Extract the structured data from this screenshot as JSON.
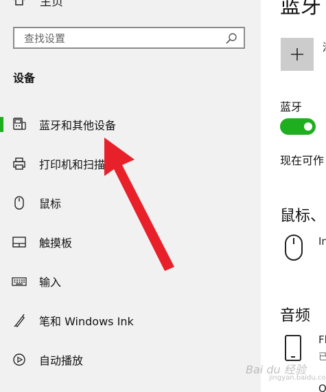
{
  "nav": {
    "home_label": "主页",
    "search": {
      "placeholder": "查找设置",
      "value": ""
    },
    "section_title": "设备",
    "items": [
      {
        "label": "蓝牙和其他设备",
        "icon": "bluetooth-devices-icon",
        "selected": true
      },
      {
        "label": "打印机和扫描仪",
        "icon": "printer-icon",
        "selected": false
      },
      {
        "label": "鼠标",
        "icon": "mouse-icon",
        "selected": false
      },
      {
        "label": "触摸板",
        "icon": "touchpad-icon",
        "selected": false
      },
      {
        "label": "输入",
        "icon": "keyboard-icon",
        "selected": false
      },
      {
        "label": "笔和 Windows Ink",
        "icon": "pen-icon",
        "selected": false
      },
      {
        "label": "自动播放",
        "icon": "autoplay-icon",
        "selected": false
      }
    ]
  },
  "content": {
    "title": "蓝牙",
    "add_device_text": "添",
    "bluetooth_label": "蓝牙",
    "bluetooth_on": true,
    "discover_text": "现在可作",
    "mouse_heading": "鼠标、",
    "mouse_device_text": "In",
    "audio_heading": "音频",
    "audio_device_text": "Fl",
    "audio_device_status": "已",
    "audio_device2_text": "Q"
  },
  "watermark": {
    "main": "Bai du 经验",
    "sub": "jingyan.baidu.com"
  },
  "colors": {
    "accent": "#1fae1f",
    "annotation": "#e8202a",
    "nav_bg": "#f1f1f1"
  }
}
